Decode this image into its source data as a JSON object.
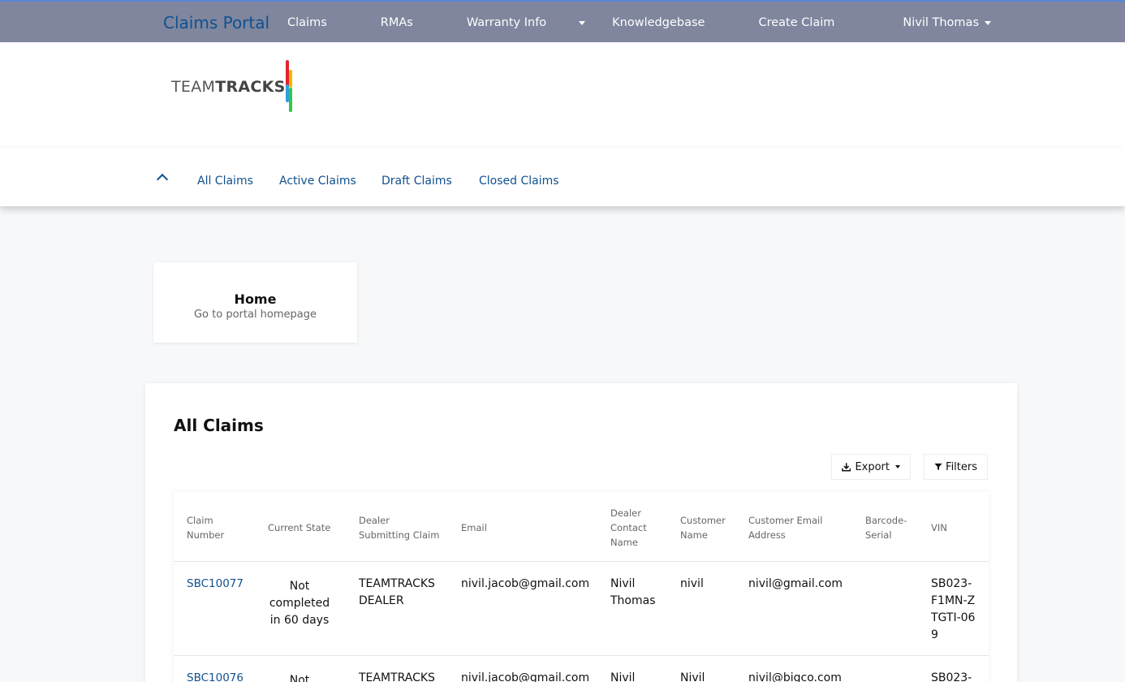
{
  "topnav": {
    "brand": "Claims Portal",
    "links": [
      "Claims",
      "RMAs",
      "Warranty Info",
      "Knowledgebase",
      "Create Claim"
    ],
    "user": "Nivil Thomas"
  },
  "logo": {
    "text_light": "TEAM",
    "text_bold": "TRACKS"
  },
  "subnav": {
    "tabs": [
      "All Claims",
      "Active Claims",
      "Draft Claims",
      "Closed Claims"
    ]
  },
  "home_card": {
    "title": "Home",
    "subtitle": "Go to portal homepage"
  },
  "claims": {
    "title": "All Claims",
    "export_label": "Export",
    "filters_label": "Filters",
    "columns": [
      "Claim Number",
      "Current State",
      "Dealer Submitting Claim",
      "Email",
      "Dealer Contact Name",
      "Customer Name",
      "Customer Email Address",
      "Barcode-Serial",
      "VIN"
    ],
    "rows": [
      {
        "claim_number": "SBC10077",
        "current_state": "Not completed in 60 days",
        "dealer": "TEAMTRACKS DEALER",
        "email": "nivil.jacob@gmail.com",
        "contact": "Nivil Thomas",
        "customer": "nivil",
        "customer_email": "nivil@gmail.com",
        "barcode": "",
        "vin": "SB023-F1MN-ZTGTI-069"
      },
      {
        "claim_number": "SBC10076",
        "current_state": "Not",
        "dealer": "TEAMTRACKS",
        "email": "nivil.jacob@gmail.com",
        "contact": "Nivil",
        "customer": "Nivil",
        "customer_email": "nivil@bigco.com",
        "barcode": "",
        "vin": "SB023-"
      }
    ]
  },
  "colors": {
    "topnav_bg": "#7f869d",
    "brand_blue": "#10508f",
    "link_blue": "#10508f"
  }
}
